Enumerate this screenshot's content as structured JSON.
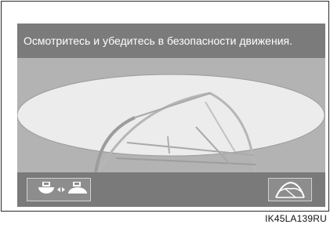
{
  "screen": {
    "message": "Осмотритесь и убедитесь в безопасности движения."
  },
  "buttons": {
    "view_mode_icon": "camera-view-switch-icon",
    "guideline_icon": "guideline-toggle-icon"
  },
  "caption": "IK45LA139RU",
  "colors": {
    "message_bar": "#7b7b7b",
    "view_background": "#b3b3b3",
    "ellipse_fill": "#ececec",
    "button_bar": "#7a7a7a"
  }
}
